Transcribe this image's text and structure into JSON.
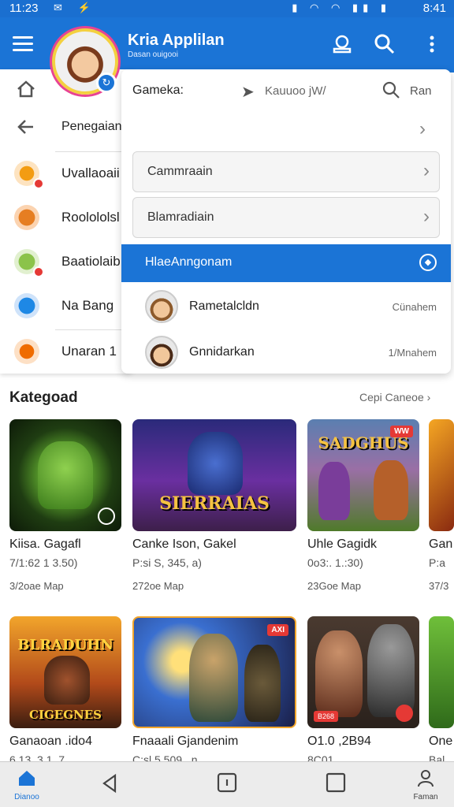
{
  "status_bar": {
    "time_left": "11:23",
    "time_right": "8:41",
    "icons_left": "✉ ⚡",
    "icons_right": "▮ ◠ ◠ ▮▮ ▮"
  },
  "app_bar": {
    "title": "Kria Applilan",
    "subtitle": "Dasan ouigooi"
  },
  "drawer": {
    "items": [
      {
        "label": "Penegaian",
        "icon": "back-arrow-icon"
      },
      {
        "label": "Uvallaoaii",
        "icon": "game-icon"
      },
      {
        "label": "Roolololsl",
        "icon": "store-icon"
      },
      {
        "label": "Baatiolaib",
        "icon": "badge-icon"
      },
      {
        "label": "Na Bang",
        "icon": "globe-icon"
      },
      {
        "label": "Unaran 1",
        "icon": "star-icon"
      }
    ]
  },
  "popup": {
    "header_label": "Gameka:",
    "header_mid": "Kauuoo jW/",
    "header_right": "Ran",
    "fields": [
      "Cammraain",
      "Blamradiain"
    ],
    "selected": "HlaeAnngonam",
    "items": [
      {
        "name": "Rametalcldn",
        "count": "Cünahem"
      },
      {
        "name": "Gnnidarkan",
        "count": "1/Mnahem"
      }
    ]
  },
  "category": {
    "title": "Kategoad",
    "link": "Cepi Caneoe ›",
    "row1": [
      {
        "name": "Kiisa. Gagafl",
        "price": "7/1:62 1 3.50)",
        "meta": "3/2oae Map"
      },
      {
        "name": "Canke Ison, Gakel",
        "price": "P:si S, 345,  a)",
        "meta": "272oe Map",
        "logo": "SIERRAIAS"
      },
      {
        "name": "Uhle Gagidk",
        "price": "0o3:. 1.:30)",
        "meta": "23Goe Map",
        "logo": "SADGHUS",
        "tag": "WW"
      },
      {
        "name": "Gan",
        "price": "P:a",
        "meta": "37/3"
      }
    ],
    "row2": [
      {
        "name": "Ganaoan .ido4",
        "price": "6.13, 3 1 .7",
        "logo_top": "BLRADUHN",
        "logo_bottom": "CIGEGNES"
      },
      {
        "name": "Fnaaali Gjandenim",
        "price": "C:sl 5 509 . n",
        "tag": "AXI"
      },
      {
        "name": "O1.0 ,2B94",
        "price": "8C01",
        "tag_bottom": "B268"
      },
      {
        "name": "One",
        "price": "Bal"
      }
    ]
  },
  "bottom_nav": {
    "home_label": "Dianoo",
    "profile_label": "Faman"
  },
  "colors": {
    "primary": "#1b74d6",
    "accent_red": "#e53935"
  }
}
